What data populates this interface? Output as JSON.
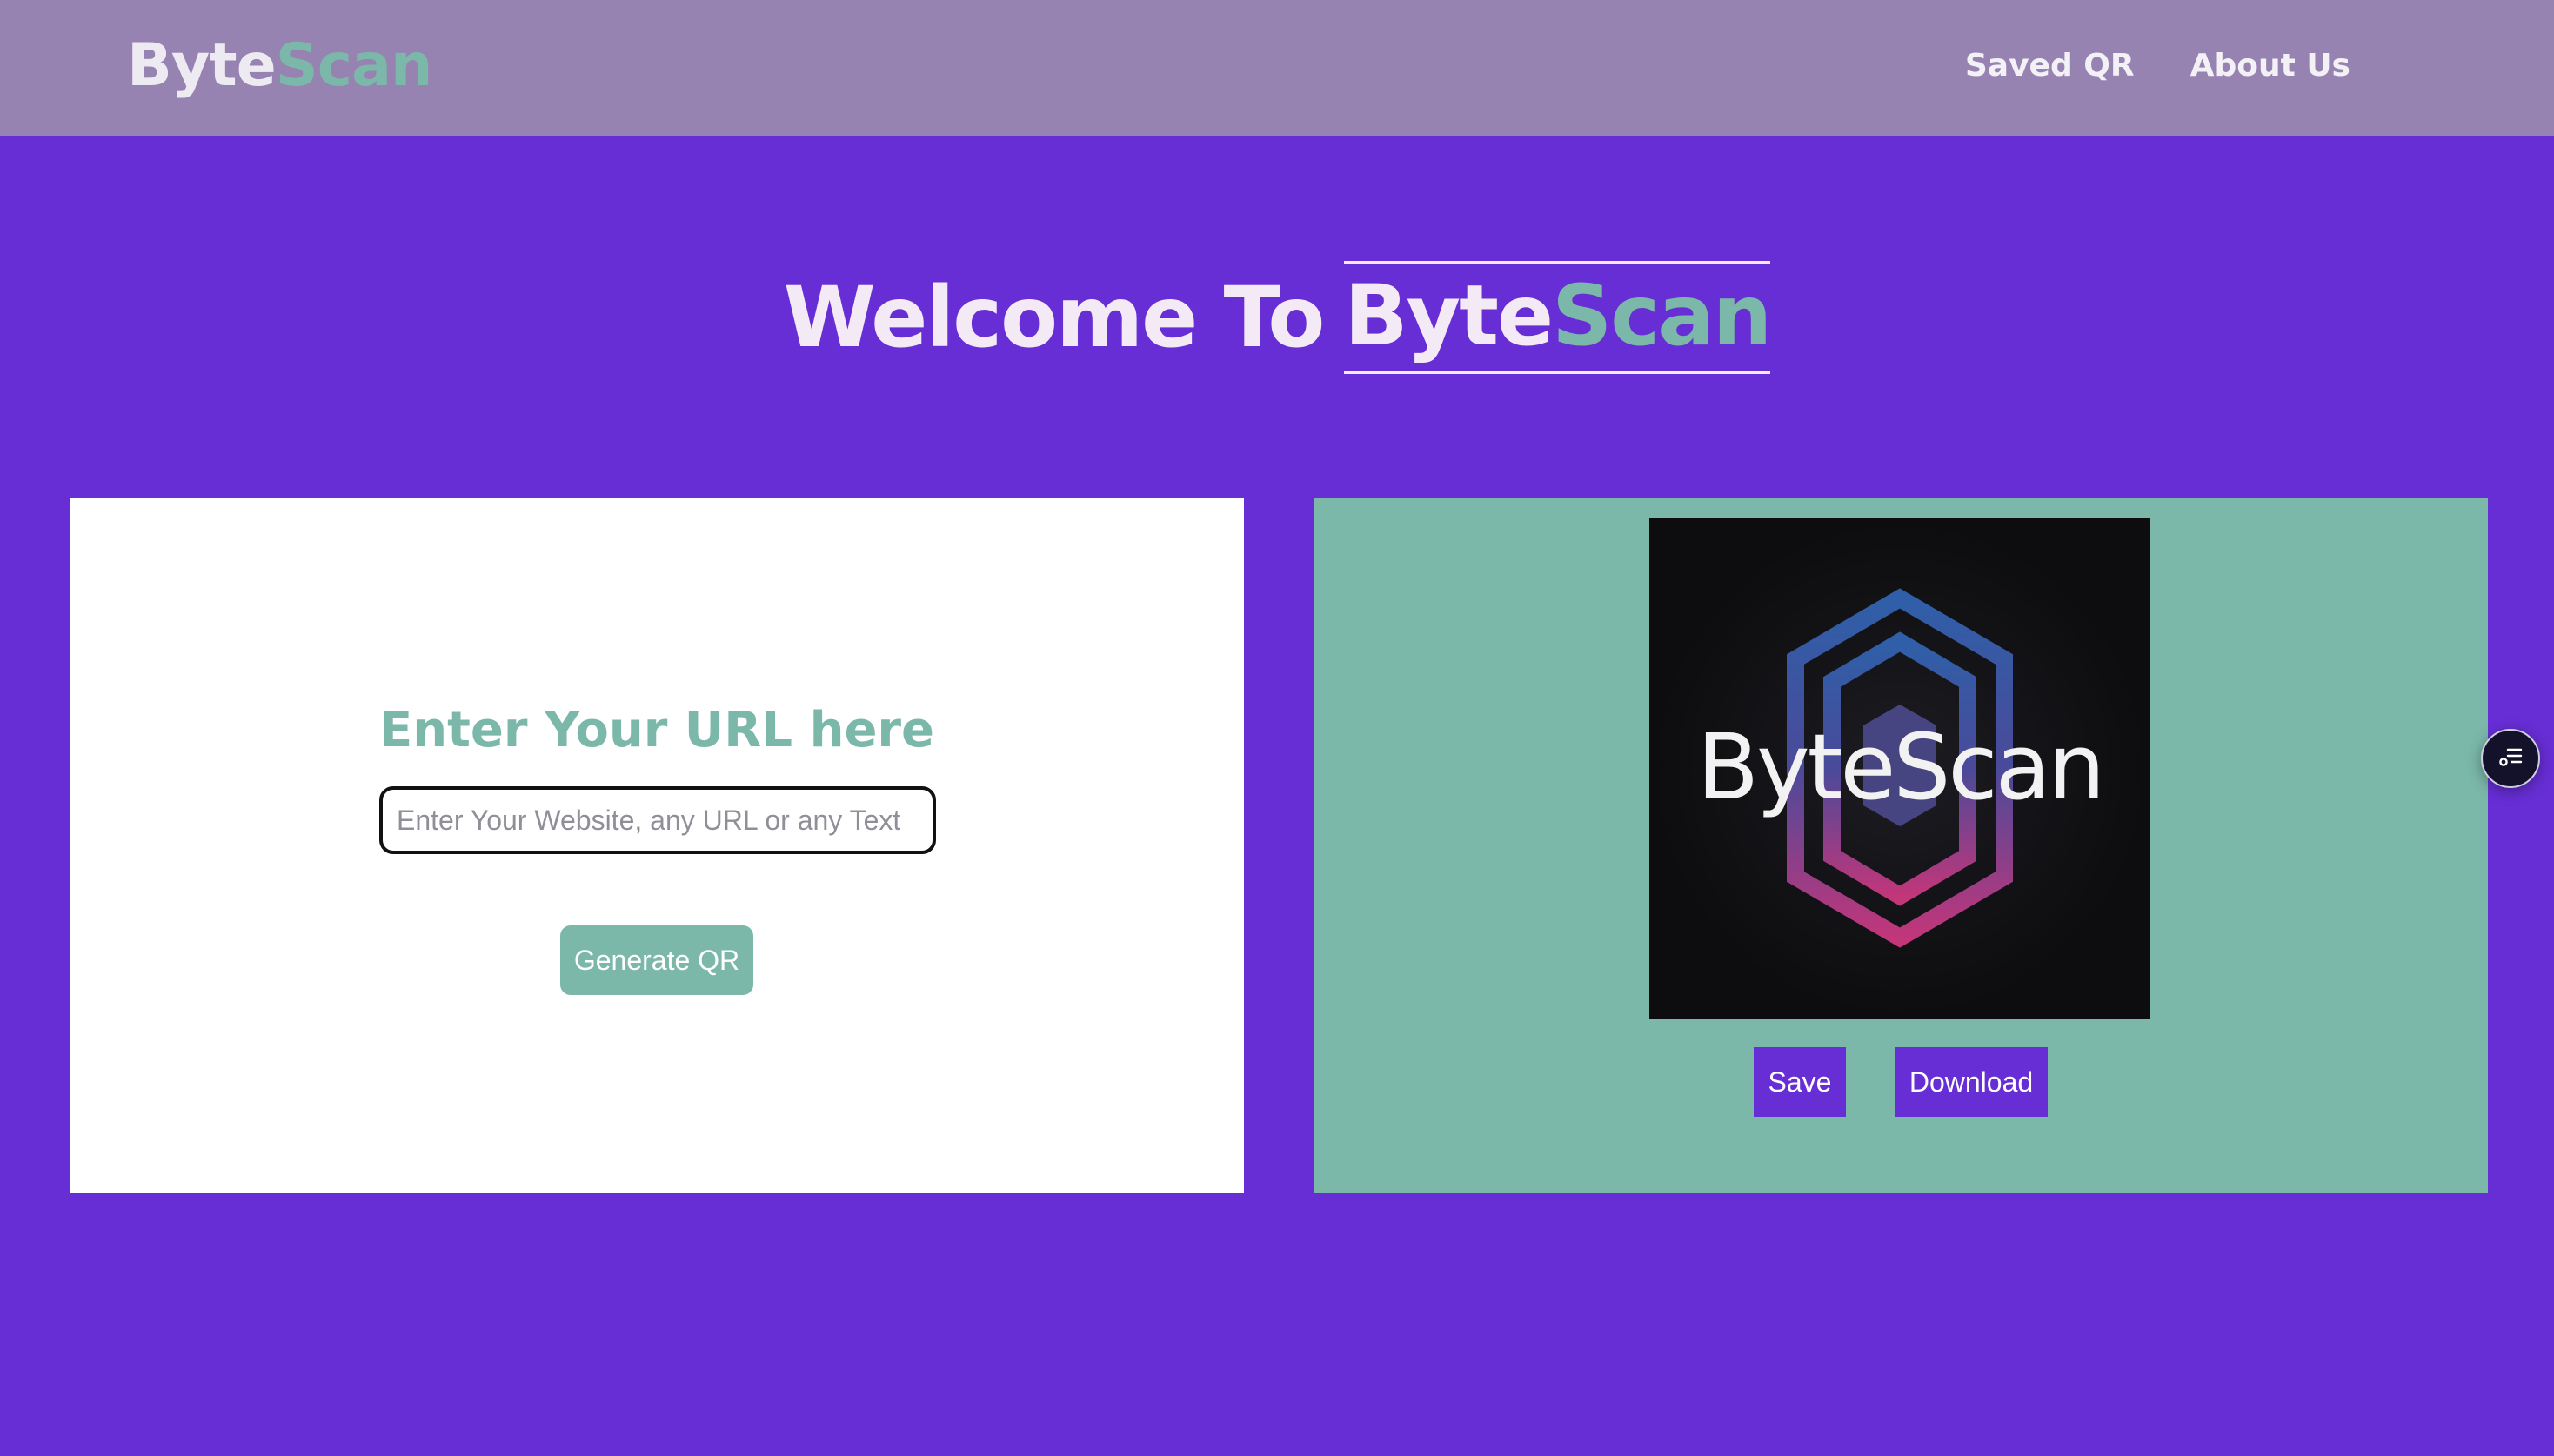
{
  "navbar": {
    "brand_part1": "Byte",
    "brand_part2": "Scan",
    "links": [
      "Saved QR",
      "About Us"
    ]
  },
  "hero": {
    "prefix": "Welcome To",
    "brand_part1": "Byte",
    "brand_part2": "Scan"
  },
  "input_card": {
    "heading": "Enter Your URL here",
    "input_placeholder": "Enter Your Website, any URL or any Text",
    "input_value": "",
    "generate_label": "Generate QR"
  },
  "preview_card": {
    "image_text": "ByteScan",
    "save_label": "Save",
    "download_label": "Download"
  },
  "floating_widget": {
    "icon": "list-settings-icon"
  },
  "colors": {
    "page_background": "#672ed5",
    "navbar_background": "#9683b2",
    "accent_teal": "#7bb8a9",
    "button_purple": "#672ed5",
    "text_light": "#f3eaf6"
  }
}
